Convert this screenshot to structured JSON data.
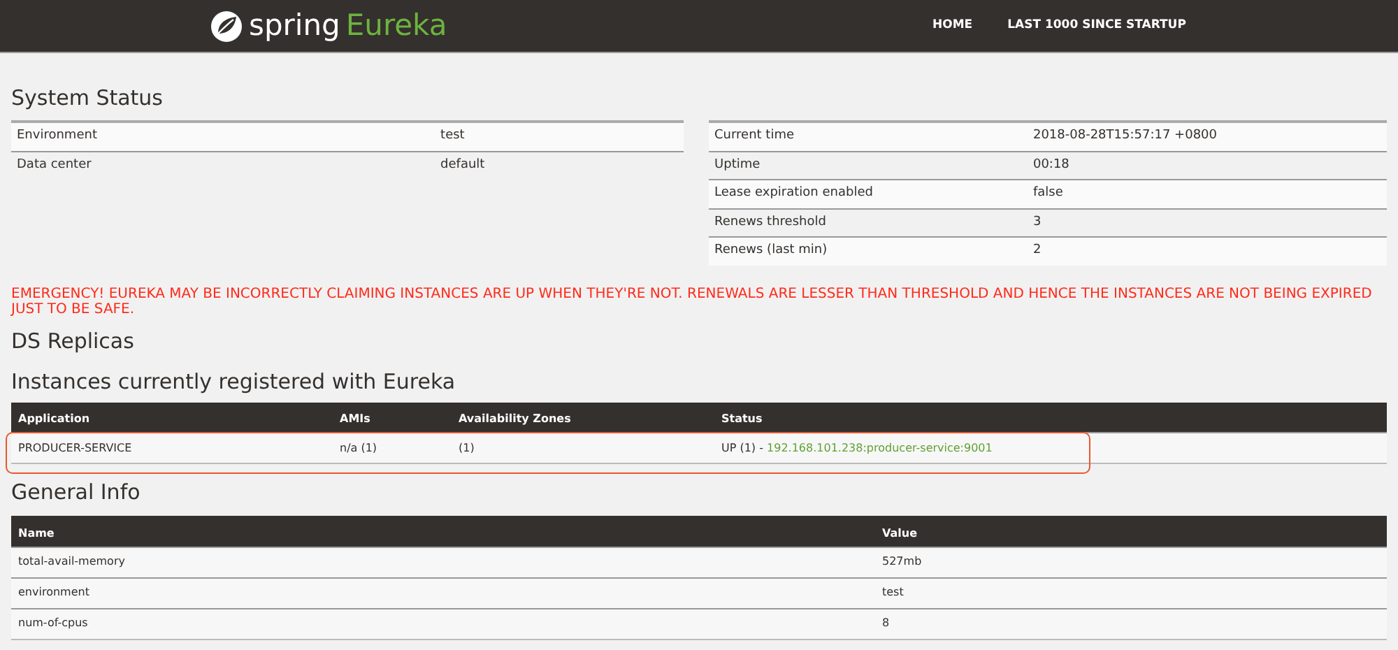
{
  "navbar": {
    "brand": {
      "name": "spring",
      "product": "Eureka"
    },
    "links": [
      "HOME",
      "LAST 1000 SINCE STARTUP"
    ]
  },
  "system_status": {
    "title": "System Status",
    "left_rows": [
      {
        "label": "Environment",
        "value": "test"
      },
      {
        "label": "Data center",
        "value": "default"
      }
    ],
    "right_rows": [
      {
        "label": "Current time",
        "value": "2018-08-28T15:57:17 +0800"
      },
      {
        "label": "Uptime",
        "value": "00:18"
      },
      {
        "label": "Lease expiration enabled",
        "value": "false"
      },
      {
        "label": "Renews threshold",
        "value": "3"
      },
      {
        "label": "Renews (last min)",
        "value": "2"
      }
    ]
  },
  "emergency": "EMERGENCY! EUREKA MAY BE INCORRECTLY CLAIMING INSTANCES ARE UP WHEN THEY'RE NOT. RENEWALS ARE LESSER THAN THRESHOLD AND HENCE THE INSTANCES ARE NOT BEING EXPIRED JUST TO BE SAFE.",
  "ds_replicas": {
    "title": "DS Replicas"
  },
  "instances": {
    "title": "Instances currently registered with Eureka",
    "columns": [
      "Application",
      "AMIs",
      "Availability Zones",
      "Status"
    ],
    "rows": [
      {
        "application": "PRODUCER-SERVICE",
        "amis": "n/a (1)",
        "zones": "(1)",
        "status": "UP (1) - ",
        "instance_link": "192.168.101.238:producer-service:9001",
        "highlighted": true
      }
    ]
  },
  "general_info": {
    "title": "General Info",
    "columns": [
      "Name",
      "Value"
    ],
    "rows": [
      {
        "name": "total-avail-memory",
        "value": "527mb"
      },
      {
        "name": "environment",
        "value": "test"
      },
      {
        "name": "num-of-cpus",
        "value": "8"
      }
    ]
  }
}
